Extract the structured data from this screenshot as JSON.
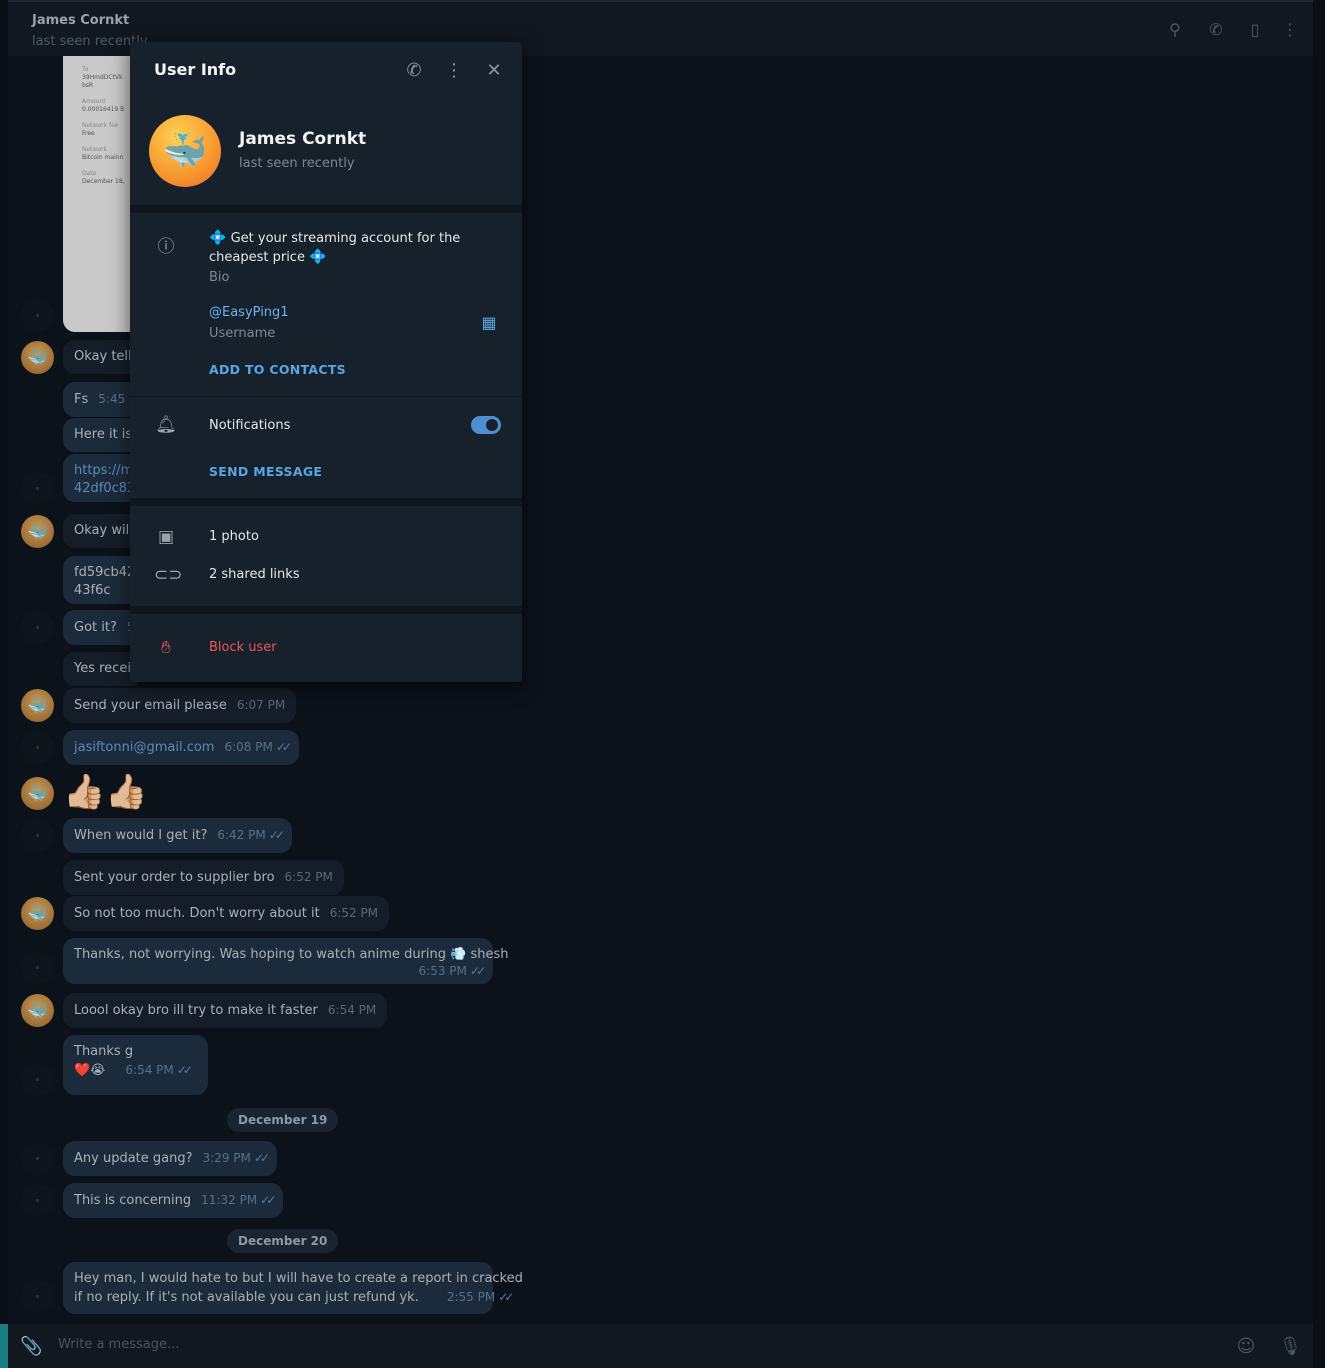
{
  "chat": {
    "title": "James Cornkt",
    "status": "last seen recently",
    "preview": {
      "to_label": "To",
      "to_value_1": "39HmdDCtVk",
      "to_value_2": "bsR",
      "amount_label": "Amount",
      "amount_value": "0.00016419 B",
      "fee_label": "Network fee",
      "fee_value": "Free",
      "network_label": "Network",
      "network_value": "Bitcoin mainn",
      "date_label": "Date",
      "date_value": "December 18,"
    },
    "messages": [
      {
        "text": "Okay tell"
      },
      {
        "text": "Fs",
        "time": "5:45 P"
      },
      {
        "text": "Here it is"
      },
      {
        "text": "https://m",
        "text2": "42df0c83"
      },
      {
        "text": "Okay will"
      },
      {
        "text": "fd59cb42l",
        "text2": "43f6c"
      },
      {
        "text": "Got it?",
        "time": "5"
      },
      {
        "text": "Yes receiv"
      },
      {
        "text": "Send your email please",
        "time": "6:07 PM"
      },
      {
        "text": "jasiftonni@gmail.com",
        "time": "6:08 PM"
      },
      {
        "text": "👍🏼👍🏼"
      },
      {
        "text": "When would I get it?",
        "time": "6:42 PM"
      },
      {
        "text": "Sent your order to supplier bro",
        "time": "6:52 PM"
      },
      {
        "text": "So not too much. Don't worry about it",
        "time": "6:52 PM"
      },
      {
        "text": "Thanks, not worrying. Was hoping to watch anime during 💨 shesh",
        "time": "6:53 PM"
      },
      {
        "text": "Loool okay bro ill try to make it faster",
        "time": "6:54 PM"
      },
      {
        "text": "Thanks g",
        "reactions": "❤️😭",
        "time": "6:54 PM"
      },
      {
        "text": "Any update gang?",
        "time": "3:29 PM"
      },
      {
        "text": "This is concerning",
        "time": "11:32 PM"
      },
      {
        "text": "Hey man, I would hate to but I will have to create a report in cracked",
        "text2": "if no reply. If it's not available you can just refund yk.",
        "time": "2:55 PM"
      }
    ],
    "dates": [
      "December 19",
      "December 20"
    ],
    "composer_placeholder": "Write a message..."
  },
  "panel": {
    "title": "User Info",
    "name": "James Cornkt",
    "status": "last seen recently",
    "bio": "Get your streaming account for the cheapest price",
    "bio_label": "Bio",
    "username": "@EasyPing1",
    "username_label": "Username",
    "add_contacts": "ADD TO CONTACTS",
    "notifications": "Notifications",
    "notifications_on": true,
    "send_message": "SEND MESSAGE",
    "photos": "1 photo",
    "links": "2 shared links",
    "block": "Block user"
  },
  "colors": {
    "accent": "#5aa6e3",
    "danger": "#e85757",
    "panel_bg": "#17212b"
  }
}
